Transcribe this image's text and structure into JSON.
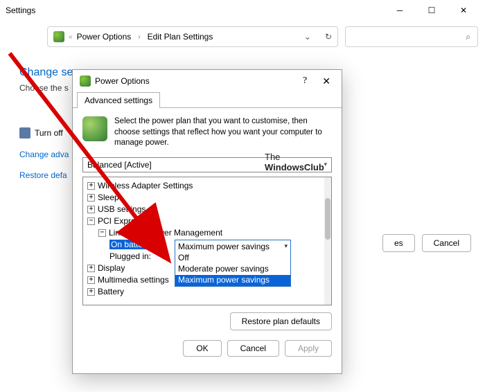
{
  "window": {
    "title": "Settings"
  },
  "breadcrumb": {
    "item1": "Power Options",
    "item2": "Edit Plan Settings"
  },
  "bg": {
    "heading": "Change se",
    "sub": "Choose the s",
    "turnoff": "Turn off",
    "change_adv": "Change adva",
    "restore": "Restore defa"
  },
  "bgButtons": {
    "es": "es",
    "cancel": "Cancel"
  },
  "dialog": {
    "title": "Power Options",
    "tab": "Advanced settings",
    "intro": "Select the power plan that you want to customise, then choose settings that reflect how you want your computer to manage power.",
    "plan": "Balanced [Active]",
    "restore_btn": "Restore plan defaults",
    "ok": "OK",
    "cancel": "Cancel",
    "apply": "Apply"
  },
  "tree": {
    "wireless": "Wireless Adapter Settings",
    "sleep": "Sleep",
    "usb": "USB settings",
    "pci": "PCI Express",
    "linkstate": "Link State Power Management",
    "onbatt": "On battery:",
    "plugged": "Plugged in:",
    "display": "Display",
    "multimedia": "Multimedia settings",
    "battery": "Battery"
  },
  "combo": {
    "value": "Maximum power savings",
    "opt_off": "Off",
    "opt_mod": "Moderate power savings",
    "opt_max": "Maximum power savings"
  },
  "watermark": {
    "line1": "The",
    "line2": "WindowsClub"
  }
}
